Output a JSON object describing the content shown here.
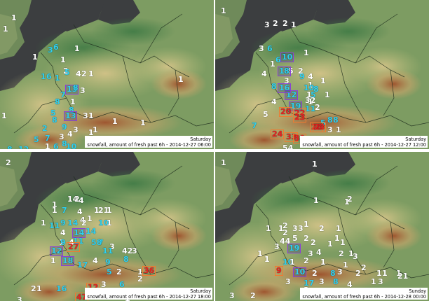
{
  "panels": [
    {
      "id": "p1",
      "day": "Saturday",
      "caption": "snowfall, amount of fresh past 6h - 2014-12-27 06:00",
      "labels": [
        {
          "t": "1",
          "c": "w"
        },
        {
          "t": "1",
          "c": "w"
        },
        {
          "t": "3",
          "c": "c"
        },
        {
          "t": "6",
          "c": "c"
        },
        {
          "t": "1",
          "c": "w"
        },
        {
          "t": "1",
          "c": "w"
        },
        {
          "t": "2",
          "c": "w"
        },
        {
          "t": "1",
          "c": "w"
        },
        {
          "t": "1",
          "c": "c"
        },
        {
          "t": "6",
          "c": "c"
        },
        {
          "t": "5",
          "c": "c"
        },
        {
          "t": "1",
          "c": "c"
        },
        {
          "t": "7",
          "c": "c"
        },
        {
          "t": "8",
          "c": "c"
        },
        {
          "t": "4",
          "c": "w"
        },
        {
          "t": "2",
          "c": "w"
        },
        {
          "t": "1",
          "c": "w"
        },
        {
          "t": "1",
          "c": "w"
        },
        {
          "t": "13",
          "c": "c"
        },
        {
          "t": "8",
          "c": "c"
        },
        {
          "t": "3",
          "c": "w"
        },
        {
          "t": "5",
          "c": "c"
        },
        {
          "t": "1",
          "c": "w"
        },
        {
          "t": "9",
          "c": "c"
        },
        {
          "t": "8",
          "c": "c"
        },
        {
          "t": "2",
          "c": "c"
        },
        {
          "t": "8",
          "c": "c"
        },
        {
          "t": "13",
          "c": "c"
        },
        {
          "t": "3",
          "c": "w"
        },
        {
          "t": "1",
          "c": "w"
        },
        {
          "t": "7",
          "c": "c"
        },
        {
          "t": "3",
          "c": "w"
        },
        {
          "t": "4",
          "c": "w"
        },
        {
          "t": "3",
          "c": "w"
        },
        {
          "t": "8",
          "c": "c"
        },
        {
          "t": "6",
          "c": "c"
        },
        {
          "t": "1",
          "c": "w"
        },
        {
          "t": "10",
          "c": "c"
        },
        {
          "t": "1",
          "c": "w"
        },
        {
          "t": "1",
          "c": "w"
        },
        {
          "t": "1",
          "c": "w"
        },
        {
          "t": "1",
          "c": "w"
        },
        {
          "t": "1",
          "c": "w"
        },
        {
          "t": "12",
          "c": "c"
        },
        {
          "t": "8",
          "c": "c"
        },
        {
          "t": "5",
          "c": "c"
        }
      ]
    },
    {
      "id": "p2",
      "day": "Saturday",
      "caption": "snowfall, amount of fresh past 6h - 2014-12-27 12:00",
      "labels": [
        {
          "t": "1",
          "c": "w"
        },
        {
          "t": "3",
          "c": "w"
        },
        {
          "t": "2",
          "c": "w"
        },
        {
          "t": "2",
          "c": "w"
        },
        {
          "t": "1",
          "c": "w"
        },
        {
          "t": "3",
          "c": "w"
        },
        {
          "t": "6",
          "c": "c"
        },
        {
          "t": "5",
          "c": "w"
        },
        {
          "t": "1",
          "c": "w"
        },
        {
          "t": "10",
          "c": "c"
        },
        {
          "t": "6",
          "c": "c"
        },
        {
          "t": "2",
          "c": "w"
        },
        {
          "t": "1",
          "c": "w"
        },
        {
          "t": "4",
          "c": "w"
        },
        {
          "t": "1",
          "c": "w"
        },
        {
          "t": "13",
          "c": "c"
        },
        {
          "t": "8",
          "c": "c"
        },
        {
          "t": "9",
          "c": "c"
        },
        {
          "t": "4",
          "c": "w"
        },
        {
          "t": "1",
          "c": "w"
        },
        {
          "t": "3",
          "c": "w"
        },
        {
          "t": "12",
          "c": "c"
        },
        {
          "t": "1",
          "c": "w"
        },
        {
          "t": "8",
          "c": "c"
        },
        {
          "t": "16",
          "c": "c"
        },
        {
          "t": "10",
          "c": "c"
        },
        {
          "t": "8",
          "c": "c"
        },
        {
          "t": "5",
          "c": "c"
        },
        {
          "t": "1",
          "c": "w"
        },
        {
          "t": "4",
          "c": "w"
        },
        {
          "t": "19",
          "c": "c"
        },
        {
          "t": "32",
          "c": "w"
        },
        {
          "t": "11",
          "c": "c"
        },
        {
          "t": "2",
          "c": "w"
        },
        {
          "t": "5",
          "c": "w"
        },
        {
          "t": "20",
          "c": "r"
        },
        {
          "t": "22",
          "c": "r"
        },
        {
          "t": "7",
          "c": "c"
        },
        {
          "t": "1",
          "c": "w"
        },
        {
          "t": "23",
          "c": "r"
        },
        {
          "t": "5",
          "c": "c"
        },
        {
          "t": "8",
          "c": "c"
        },
        {
          "t": "8",
          "c": "c"
        },
        {
          "t": "3",
          "c": "w"
        },
        {
          "t": "1",
          "c": "w"
        },
        {
          "t": "24",
          "c": "r"
        },
        {
          "t": "33",
          "c": "r"
        },
        {
          "t": "39",
          "c": "r"
        },
        {
          "t": "28",
          "c": "r"
        },
        {
          "t": "23",
          "c": "r"
        },
        {
          "t": "54",
          "c": "w"
        },
        {
          "t": "9",
          "c": "c"
        }
      ]
    },
    {
      "id": "p3",
      "day": "Saturday",
      "caption": "snowfall, amount of fresh past 6h - 2014-12-27 18:00",
      "labels": [
        {
          "t": "2",
          "c": "w"
        },
        {
          "t": "14",
          "c": "w"
        },
        {
          "t": "2",
          "c": "w"
        },
        {
          "t": "1",
          "c": "w"
        },
        {
          "t": "4",
          "c": "w"
        },
        {
          "t": "1",
          "c": "w"
        },
        {
          "t": "7",
          "c": "c"
        },
        {
          "t": "4",
          "c": "w"
        },
        {
          "t": "1",
          "c": "w"
        },
        {
          "t": "1",
          "c": "w"
        },
        {
          "t": "4",
          "c": "w"
        },
        {
          "t": "21",
          "c": "w"
        },
        {
          "t": "1",
          "c": "w"
        },
        {
          "t": "1",
          "c": "w"
        },
        {
          "t": "11",
          "c": "c"
        },
        {
          "t": "9",
          "c": "c"
        },
        {
          "t": "14",
          "c": "c"
        },
        {
          "t": "10",
          "c": "c"
        },
        {
          "t": "2",
          "c": "w"
        },
        {
          "t": "1",
          "c": "w"
        },
        {
          "t": "4",
          "c": "w"
        },
        {
          "t": "14",
          "c": "c"
        },
        {
          "t": "14",
          "c": "c"
        },
        {
          "t": "4",
          "c": "w"
        },
        {
          "t": "1",
          "c": "w"
        },
        {
          "t": "9",
          "c": "c"
        },
        {
          "t": "11",
          "c": "c"
        },
        {
          "t": "7",
          "c": "c"
        },
        {
          "t": "58",
          "c": "c"
        },
        {
          "t": "3",
          "c": "w"
        },
        {
          "t": "12",
          "c": "c"
        },
        {
          "t": "27",
          "c": "r"
        },
        {
          "t": "11",
          "c": "c"
        },
        {
          "t": "42",
          "c": "w"
        },
        {
          "t": "3",
          "c": "w"
        },
        {
          "t": "1",
          "c": "w"
        },
        {
          "t": "18",
          "c": "c"
        },
        {
          "t": "17",
          "c": "c"
        },
        {
          "t": "4",
          "c": "w"
        },
        {
          "t": "9",
          "c": "c"
        },
        {
          "t": "8",
          "c": "c"
        },
        {
          "t": "5",
          "c": "c"
        },
        {
          "t": "2",
          "c": "w"
        },
        {
          "t": "1",
          "c": "w"
        },
        {
          "t": "36",
          "c": "r"
        },
        {
          "t": "2",
          "c": "w"
        },
        {
          "t": "1",
          "c": "w"
        },
        {
          "t": "16",
          "c": "c"
        },
        {
          "t": "12",
          "c": "r"
        },
        {
          "t": "2",
          "c": "w"
        },
        {
          "t": "6",
          "c": "c"
        },
        {
          "t": "3",
          "c": "w"
        },
        {
          "t": "47",
          "c": "r"
        },
        {
          "t": "5",
          "c": "c"
        },
        {
          "t": "3",
          "c": "w"
        },
        {
          "t": "1",
          "c": "w"
        }
      ]
    },
    {
      "id": "p4",
      "day": "Sunday",
      "caption": "snowfall, amount of fresh past 6h - 2014-12-28 00:00",
      "labels": [
        {
          "t": "1",
          "c": "w"
        },
        {
          "t": "1",
          "c": "w"
        },
        {
          "t": "1",
          "c": "w"
        },
        {
          "t": "2",
          "c": "w"
        },
        {
          "t": "1",
          "c": "w"
        },
        {
          "t": "1",
          "c": "w"
        },
        {
          "t": "1",
          "c": "w"
        },
        {
          "t": "2",
          "c": "w"
        },
        {
          "t": "3",
          "c": "w"
        },
        {
          "t": "3",
          "c": "w"
        },
        {
          "t": "1",
          "c": "w"
        },
        {
          "t": "2",
          "c": "w"
        },
        {
          "t": "1",
          "c": "w"
        },
        {
          "t": "2",
          "c": "w"
        },
        {
          "t": "44",
          "c": "w"
        },
        {
          "t": "5",
          "c": "w"
        },
        {
          "t": "2",
          "c": "w"
        },
        {
          "t": "2",
          "c": "w"
        },
        {
          "t": "1",
          "c": "w"
        },
        {
          "t": "1",
          "c": "w"
        },
        {
          "t": "3",
          "c": "w"
        },
        {
          "t": "19",
          "c": "c"
        },
        {
          "t": "3",
          "c": "w"
        },
        {
          "t": "4",
          "c": "w"
        },
        {
          "t": "1",
          "c": "w"
        },
        {
          "t": "2",
          "c": "w"
        },
        {
          "t": "1",
          "c": "w"
        },
        {
          "t": "1",
          "c": "w"
        },
        {
          "t": "1",
          "c": "w"
        },
        {
          "t": "10",
          "c": "c"
        },
        {
          "t": "1",
          "c": "w"
        },
        {
          "t": "2",
          "c": "w"
        },
        {
          "t": "1",
          "c": "w"
        },
        {
          "t": "1",
          "c": "w"
        },
        {
          "t": "3",
          "c": "w"
        },
        {
          "t": "2",
          "c": "w"
        },
        {
          "t": "1",
          "c": "w"
        },
        {
          "t": "1",
          "c": "w"
        },
        {
          "t": "9",
          "c": "r"
        },
        {
          "t": "10",
          "c": "c"
        },
        {
          "t": "2",
          "c": "w"
        },
        {
          "t": "8",
          "c": "c"
        },
        {
          "t": "3",
          "c": "w"
        },
        {
          "t": "2",
          "c": "w"
        },
        {
          "t": "1",
          "c": "w"
        },
        {
          "t": "21",
          "c": "w"
        },
        {
          "t": "3",
          "c": "w"
        },
        {
          "t": "17",
          "c": "c"
        },
        {
          "t": "3",
          "c": "w"
        },
        {
          "t": "8",
          "c": "c"
        },
        {
          "t": "4",
          "c": "w"
        },
        {
          "t": "1",
          "c": "w"
        },
        {
          "t": "3",
          "c": "w"
        },
        {
          "t": "7",
          "c": "c"
        },
        {
          "t": "3",
          "c": "w"
        },
        {
          "t": "12",
          "c": "c"
        },
        {
          "t": "13",
          "c": "c"
        },
        {
          "t": "4",
          "c": "w"
        },
        {
          "t": "14",
          "c": "c"
        },
        {
          "t": "1",
          "c": "w"
        },
        {
          "t": "3",
          "c": "w"
        },
        {
          "t": "2",
          "c": "w"
        }
      ]
    }
  ]
}
